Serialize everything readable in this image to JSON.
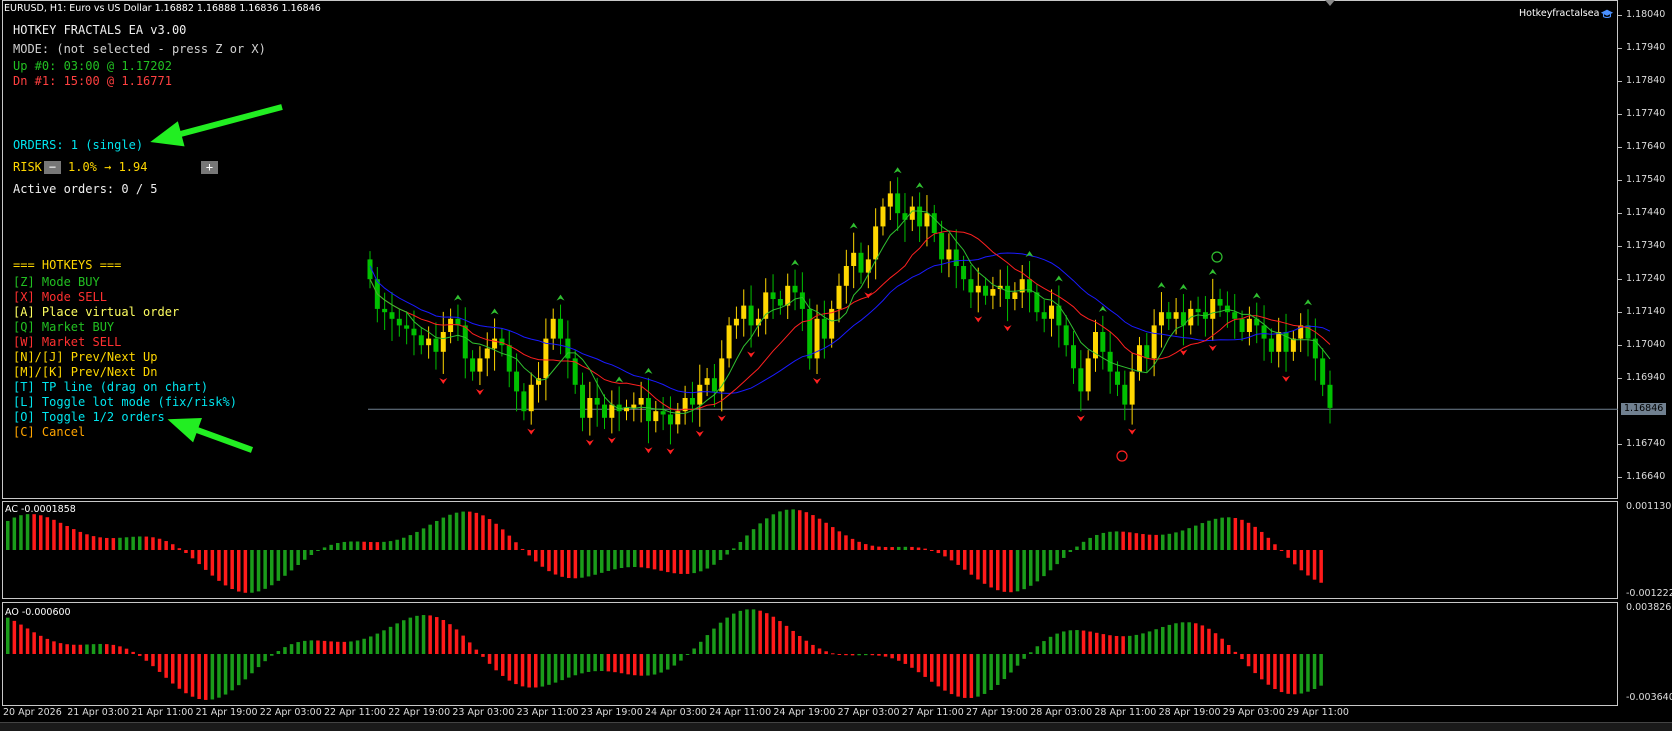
{
  "header": {
    "title": "EURUSD, H1:  Euro vs US Dollar  1.16882 1.16888 1.16836 1.16846",
    "ea_name": "Hotkeyfractalsea"
  },
  "overlay": {
    "title": "HOTKEY FRACTALS EA v3.00",
    "mode": "MODE: (not selected - press Z or X)",
    "up_fractal": "Up #0: 03:00 @ 1.17202",
    "dn_fractal": "Dn #1: 15:00 @ 1.16771",
    "orders": "ORDERS: 1 (single)",
    "risk_label": "RISK",
    "risk_minus": "−",
    "risk_value": "1.0% → 1.94",
    "risk_plus": "+",
    "active_orders": "Active orders: 0 / 5",
    "hotkeys_title": "=== HOTKEYS ===",
    "hotkeys": [
      {
        "text": "[Z] Mode BUY",
        "color": "#22c022"
      },
      {
        "text": "[X] Mode SELL",
        "color": "#ff3030"
      },
      {
        "text": "[A] Place virtual order",
        "color": "#ffff60"
      },
      {
        "text": "[Q] Market BUY",
        "color": "#22c022"
      },
      {
        "text": "[W] Market SELL",
        "color": "#ff3030"
      },
      {
        "text": "[N]/[J] Prev/Next Up",
        "color": "#ffd700"
      },
      {
        "text": "[M]/[K] Prev/Next Dn",
        "color": "#ffd700"
      },
      {
        "text": "[T] TP line (drag on chart)",
        "color": "#00e5ee"
      },
      {
        "text": "[L] Toggle lot mode (fix/risk%)",
        "color": "#00e5ee"
      },
      {
        "text": "[O] Toggle 1/2 orders",
        "color": "#00e5ee"
      },
      {
        "text": "[C] Cancel",
        "color": "#ffa500"
      }
    ]
  },
  "price_axis": {
    "labels": [
      "1.18040",
      "1.17940",
      "1.17840",
      "1.17740",
      "1.17640",
      "1.17540",
      "1.17440",
      "1.17340",
      "1.17240",
      "1.17140",
      "1.17040",
      "1.16940",
      "1.16740",
      "1.16640"
    ],
    "current_price": "1.16846"
  },
  "ac_indicator": {
    "label": "AC -0.0001858",
    "max_label": "0.0011302",
    "min_label": "-0.0012223"
  },
  "ao_indicator": {
    "label": "AO -0.000600",
    "max_label": "0.003826",
    "min_label": "-0.003640"
  },
  "time_axis": {
    "labels": [
      "20 Apr 2026",
      "21 Apr 03:00",
      "21 Apr 11:00",
      "21 Apr 19:00",
      "22 Apr 03:00",
      "22 Apr 11:00",
      "22 Apr 19:00",
      "23 Apr 03:00",
      "23 Apr 11:00",
      "23 Apr 19:00",
      "24 Apr 03:00",
      "24 Apr 11:00",
      "24 Apr 19:00",
      "27 Apr 03:00",
      "27 Apr 11:00",
      "27 Apr 19:00",
      "28 Apr 03:00",
      "28 Apr 11:00",
      "28 Apr 19:00",
      "29 Apr 03:00",
      "29 Apr 11:00"
    ]
  },
  "colors": {
    "bull_candle": "#ffd700",
    "bear_candle": "#00c000",
    "ma_blue": "#1a1aff",
    "ma_red": "#ff2020",
    "ma_green": "#30c030",
    "up_fractal": "#30c030",
    "dn_fractal": "#ff2020",
    "arrow": "#22ee22"
  },
  "chart_data": {
    "type": "candlestick",
    "symbol": "EURUSD",
    "timeframe": "H1",
    "ylim": [
      1.1658,
      1.1808
    ],
    "last_price": 1.16846,
    "closes": [
      1.1724,
      1.1715,
      1.1714,
      1.1712,
      1.171,
      1.1709,
      1.1707,
      1.1704,
      1.1706,
      1.1702,
      1.1708,
      1.1712,
      1.171,
      1.17,
      1.1696,
      1.17,
      1.1703,
      1.1706,
      1.1704,
      1.1696,
      1.169,
      1.1684,
      1.1692,
      1.1694,
      1.1706,
      1.1712,
      1.1706,
      1.17,
      1.1692,
      1.1682,
      1.1688,
      1.1686,
      1.1682,
      1.1686,
      1.1684,
      1.1685,
      1.1686,
      1.1688,
      1.1681,
      1.1684,
      1.1683,
      1.168,
      1.1684,
      1.1688,
      1.1686,
      1.1692,
      1.1694,
      1.169,
      1.17,
      1.171,
      1.1712,
      1.1716,
      1.171,
      1.1712,
      1.172,
      1.1718,
      1.1716,
      1.1722,
      1.172,
      1.1715,
      1.17,
      1.1712,
      1.1706,
      1.1715,
      1.1722,
      1.1728,
      1.1732,
      1.1726,
      1.173,
      1.174,
      1.1746,
      1.175,
      1.1744,
      1.1742,
      1.1746,
      1.174,
      1.1744,
      1.1738,
      1.173,
      1.1733,
      1.1728,
      1.1724,
      1.172,
      1.1722,
      1.1719,
      1.1721,
      1.1722,
      1.1718,
      1.172,
      1.1724,
      1.172,
      1.1714,
      1.1712,
      1.1716,
      1.171,
      1.1704,
      1.1697,
      1.169,
      1.17,
      1.1708,
      1.1702,
      1.1696,
      1.1692,
      1.1686,
      1.1696,
      1.1704,
      1.17,
      1.171,
      1.1714,
      1.1712,
      1.1714,
      1.171,
      1.1715,
      1.1714,
      1.1712,
      1.1718,
      1.1716,
      1.1714,
      1.1712,
      1.1708,
      1.1712,
      1.171,
      1.1706,
      1.1702,
      1.1708,
      1.1702,
      1.1706,
      1.171,
      1.1706,
      1.17,
      1.1692,
      1.1685
    ]
  }
}
